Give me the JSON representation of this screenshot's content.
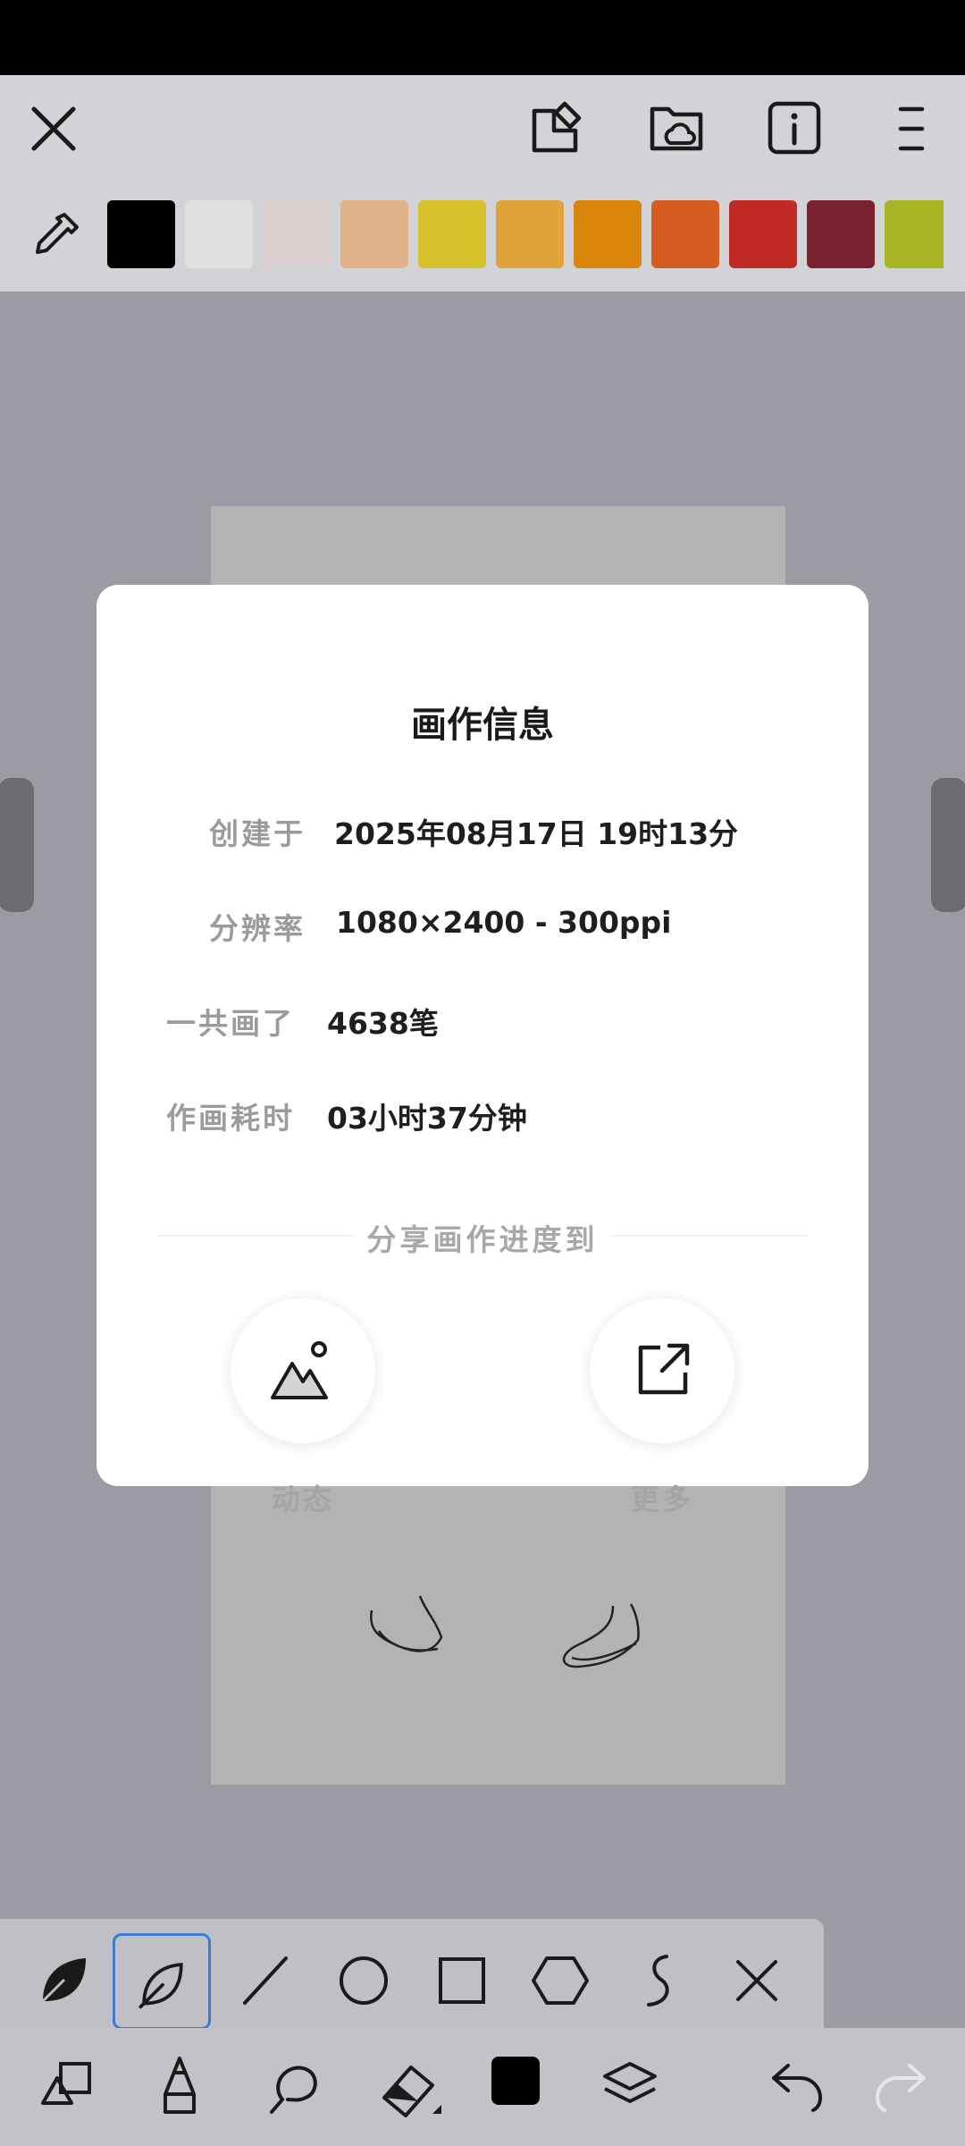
{
  "topbar": {
    "icons": [
      "close-icon",
      "pin-icon",
      "cloud-folder-icon",
      "info-icon",
      "menu-icon"
    ]
  },
  "palette": {
    "tool_icon": "eyedropper-icon",
    "colors": [
      "#000000",
      "#e0e0e0",
      "#d9cfcf",
      "#e2b38a",
      "#d7c22b",
      "#e0a23b",
      "#d9850c",
      "#d55d20",
      "#bf2a25",
      "#7a2230",
      "#a7b423"
    ]
  },
  "dialog": {
    "title": "画作信息",
    "rows": [
      {
        "label": "创建于",
        "value": "2025年08月17日  19时13分"
      },
      {
        "label": "分辨率",
        "value": "1080×2400 - 300ppi"
      },
      {
        "label": "一共画了",
        "value": "4638笔"
      },
      {
        "label": "作画耗时",
        "value": "03小时37分钟"
      }
    ],
    "share_title": "分享画作进度到",
    "share": [
      {
        "label": "动态",
        "icon": "mountain-image-icon"
      },
      {
        "label": "更多",
        "icon": "external-share-icon"
      }
    ]
  },
  "shape_tools": [
    "leaf-filled-icon",
    "leaf-outline-icon",
    "line-icon",
    "circle-icon",
    "square-icon",
    "hexagon-icon",
    "curve-icon",
    "close-icon"
  ],
  "main_tools": [
    "shapes-icon",
    "pencil-icon",
    "smudge-icon",
    "eraser-icon",
    "color-square-icon",
    "layers-icon",
    "undo-icon",
    "redo-icon"
  ],
  "selection_color": "#3a7bd5"
}
